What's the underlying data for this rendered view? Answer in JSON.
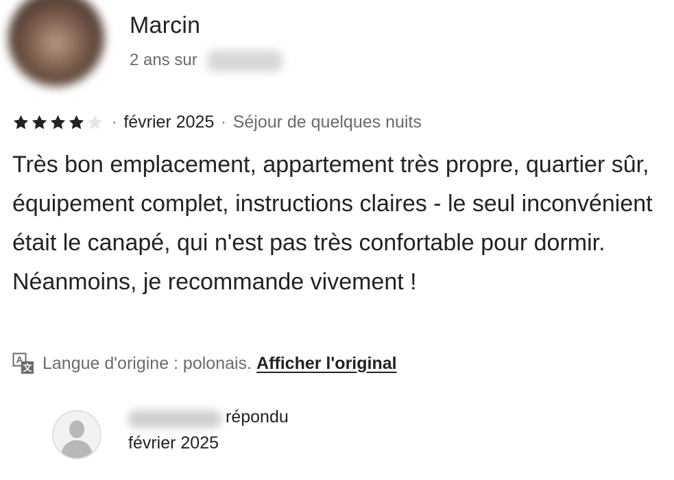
{
  "review": {
    "reviewer_name": "Marcin",
    "tenure": "2 ans sur",
    "rating": 4,
    "rating_max": 5,
    "date": "février 2025",
    "separator": "·",
    "stay_type": "Séjour de quelques nuits",
    "text": "Très bon emplacement, appartement très propre, quartier sûr, équipement complet, instructions claires - le seul inconvénient était le canapé, qui n'est pas très confortable pour dormir. Néanmoins, je recommande vivement !",
    "translation_note": "Langue d'origine : polonais.",
    "show_original_label": "Afficher l'original"
  },
  "host_response": {
    "replied_label": "répondu",
    "date": "février 2025"
  },
  "colors": {
    "text_primary": "#222222",
    "text_secondary": "#6a6a6a",
    "star_filled": "#222222",
    "star_empty": "#e6e6e6",
    "host_avatar_bg": "#f2f2f2",
    "host_avatar_fg": "#b8b8b8"
  },
  "icons": {
    "star": "star-icon",
    "translate": "translate-icon",
    "host_avatar": "user-placeholder-icon"
  }
}
